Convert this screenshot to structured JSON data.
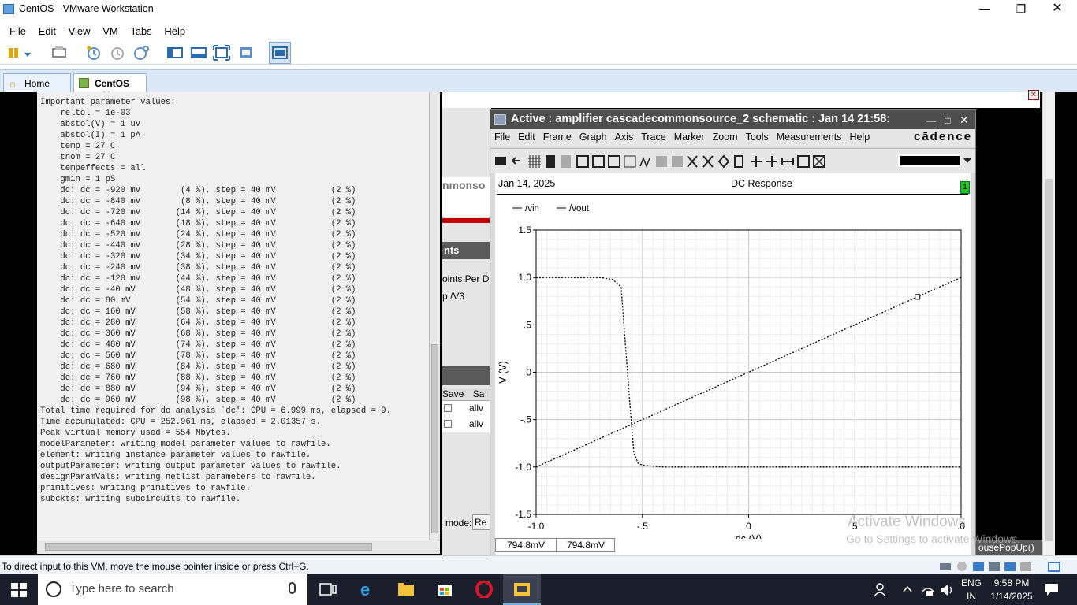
{
  "window": {
    "title": "CentOS - VMware Workstation"
  },
  "menubar": [
    "File",
    "Edit",
    "View",
    "VM",
    "Tabs",
    "Help"
  ],
  "tabs": [
    {
      "label": "Home"
    },
    {
      "label": "CentOS"
    }
  ],
  "terminal": {
    "lines": [
      "Important parameter values:",
      "    reltol = 1e-03",
      "    abstol(V) = 1 uV",
      "    abstol(I) = 1 pA",
      "    temp = 27 C",
      "    tnom = 27 C",
      "    tempeffects = all",
      "    gmin = 1 pS",
      "    dc: dc = -920 mV        (4 %), step = 40 mV           (2 %)",
      "    dc: dc = -840 mV        (8 %), step = 40 mV           (2 %)",
      "    dc: dc = -720 mV       (14 %), step = 40 mV           (2 %)",
      "    dc: dc = -640 mV       (18 %), step = 40 mV           (2 %)",
      "    dc: dc = -520 mV       (24 %), step = 40 mV           (2 %)",
      "    dc: dc = -440 mV       (28 %), step = 40 mV           (2 %)",
      "    dc: dc = -320 mV       (34 %), step = 40 mV           (2 %)",
      "    dc: dc = -240 mV       (38 %), step = 40 mV           (2 %)",
      "    dc: dc = -120 mV       (44 %), step = 40 mV           (2 %)",
      "    dc: dc = -40 mV        (48 %), step = 40 mV           (2 %)",
      "    dc: dc = 80 mV         (54 %), step = 40 mV           (2 %)",
      "    dc: dc = 160 mV        (58 %), step = 40 mV           (2 %)",
      "    dc: dc = 280 mV        (64 %), step = 40 mV           (2 %)",
      "    dc: dc = 360 mV        (68 %), step = 40 mV           (2 %)",
      "    dc: dc = 480 mV        (74 %), step = 40 mV           (2 %)",
      "    dc: dc = 560 mV        (78 %), step = 40 mV           (2 %)",
      "    dc: dc = 680 mV        (84 %), step = 40 mV           (2 %)",
      "    dc: dc = 760 mV        (88 %), step = 40 mV           (2 %)",
      "    dc: dc = 880 mV        (94 %), step = 40 mV           (2 %)",
      "    dc: dc = 960 mV        (98 %), step = 40 mV           (2 %)",
      "Total time required for dc analysis `dc': CPU = 6.999 ms, elapsed = 9.",
      "Time accumulated: CPU = 252.961 ms, elapsed = 2.01357 s.",
      "Peak virtual memory used = 554 Mbytes.",
      "",
      "modelParameter: writing model parameter values to rawfile.",
      "element: writing instance parameter values to rawfile.",
      "outputParameter: writing output parameter values to rawfile.",
      "designParamVals: writing netlist parameters to rawfile.",
      "primitives: writing primitives to rawfile.",
      "subckts: writing subcircuits to rawfile."
    ]
  },
  "background_window": {
    "fragment_title": "nmonso",
    "fragment_label": "nts",
    "fragment_col": "oints Per D",
    "fragment_row": "p /V3",
    "save_header": "Save",
    "save_header2": "Sa",
    "rows": [
      "allv",
      "allv"
    ],
    "mode_label": "mode:",
    "mode_value": "Re",
    "popup_text": "ousePopUp()"
  },
  "viva": {
    "title": "Active : amplifier cascadecommonsource_2 schematic : Jan 14 21:58:",
    "menus": [
      "File",
      "Edit",
      "Frame",
      "Graph",
      "Axis",
      "Trace",
      "Marker",
      "Zoom",
      "Tools",
      "Measurements",
      "Help"
    ],
    "brand": "cādence",
    "date": "Jan 14, 2025",
    "subwindow_title": "DC Response",
    "subwindow_index": "1",
    "readout_x": "794.8mV",
    "readout_y": "794.8mV"
  },
  "chart_data": {
    "type": "line",
    "title": "DC Response",
    "xlabel": "dc (V)",
    "ylabel": "V (V)",
    "xlim": [
      -1.0,
      1.0
    ],
    "ylim": [
      -1.5,
      1.5
    ],
    "xticks": [
      "-1.0",
      "-.5",
      "0",
      "5",
      ".0"
    ],
    "yticks": [
      "1.5",
      "1.0",
      ".5",
      "0",
      "-.5",
      "-1.0",
      "-1.5"
    ],
    "grid": true,
    "legend_position": "top-left",
    "series": [
      {
        "name": "/vin",
        "x": [
          -1.0,
          -0.5,
          0.0,
          0.5,
          1.0
        ],
        "y": [
          -1.0,
          -0.5,
          0.0,
          0.5,
          1.0
        ]
      },
      {
        "name": "/vout",
        "x": [
          -1.0,
          -0.7,
          -0.64,
          -0.6,
          -0.58,
          -0.56,
          -0.54,
          -0.52,
          -0.5,
          -0.4,
          0.0,
          0.5,
          1.0
        ],
        "y": [
          1.0,
          1.0,
          0.98,
          0.9,
          0.3,
          -0.3,
          -0.85,
          -0.96,
          -0.98,
          -1.0,
          -1.0,
          -1.0,
          -1.0
        ]
      }
    ],
    "marker": {
      "x": 0.795,
      "y": 0.795
    }
  },
  "watermark": {
    "line1": "Activate Windows",
    "line2": "Go to Settings to activate Windows."
  },
  "statusbar": {
    "text": "To direct input to this VM, move the mouse pointer inside or press Ctrl+G."
  },
  "taskbar": {
    "search_placeholder": "Type here to search",
    "lang": "ENG",
    "lang_sub": "IN",
    "time": "9:58 PM",
    "date": "1/14/2025"
  },
  "colors": {
    "accent": "#2a6bb0",
    "plot_line": "#000000",
    "taskbar": "#1a1f2b"
  }
}
